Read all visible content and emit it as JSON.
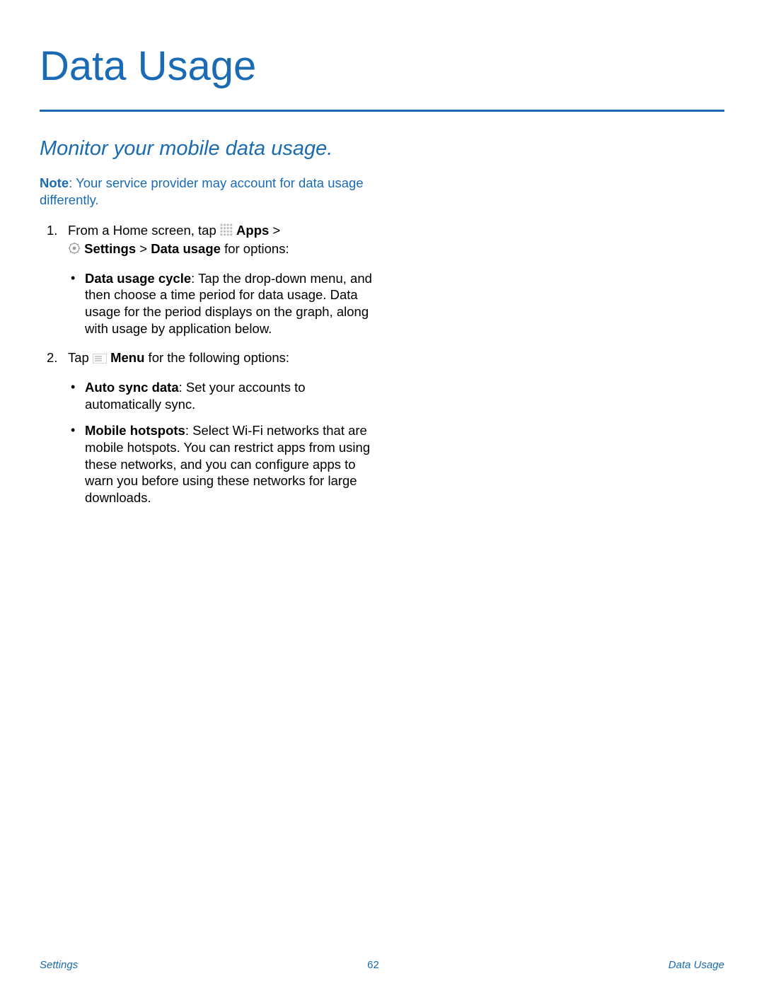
{
  "title": "Data Usage",
  "subtitle": "Monitor your mobile data usage.",
  "note": {
    "label": "Note",
    "text": ": Your service provider may account for data usage differently."
  },
  "steps": [
    {
      "prefix": "From a Home screen, tap ",
      "apps_label": "Apps",
      "gt1": "  > ",
      "settings_label": "Settings",
      "gt2": "  >  ",
      "datausage_label": "Data usage",
      "suffix": "  for options:",
      "bullets": [
        {
          "bold": "Data usage cycle",
          "text": ": Tap the drop-down menu, and then choose a time period for data usage. Data usage for the period displays on the graph, along with usage by application below."
        }
      ]
    },
    {
      "prefix": "Tap ",
      "menu_label": "Menu",
      "suffix": " for the following options:",
      "bullets": [
        {
          "bold": "Auto sync data",
          "text": ": Set your accounts to automatically sync."
        },
        {
          "bold": "Mobile hotspots",
          "text": ": Select Wi-Fi networks that are mobile hotspots. You can restrict apps from using these networks, and you can configure apps to warn you before using these networks for large downloads."
        }
      ]
    }
  ],
  "footer": {
    "left": "Settings",
    "center": "62",
    "right": "Data Usage"
  }
}
